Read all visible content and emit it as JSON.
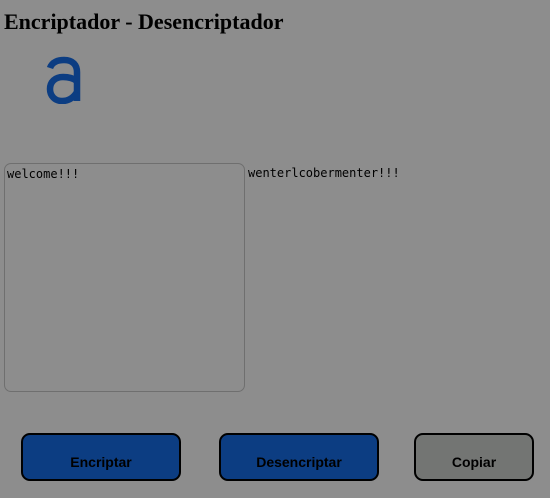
{
  "header": {
    "title": "Encriptador - Desencriptador"
  },
  "logo": {
    "icon": "alura-logo-icon",
    "glyph": "a",
    "color": "#0c3d82"
  },
  "input": {
    "value": "welcome!!!"
  },
  "output": {
    "text": "wenterlcobermenter!!!"
  },
  "buttons": {
    "encrypt_label": "Encriptar",
    "decrypt_label": "Desencriptar",
    "copy_label": "Copiar"
  },
  "colors": {
    "background": "#8d8d8d",
    "accent": "#0c3d82",
    "copy_button": "#737573"
  }
}
